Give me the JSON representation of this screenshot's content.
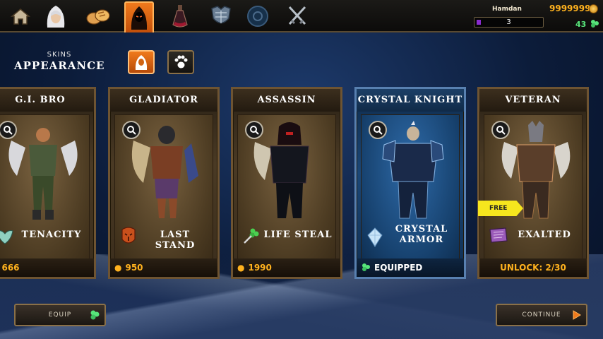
{
  "tabs": [
    {
      "id": "home",
      "icon": "home-icon"
    },
    {
      "id": "heroes",
      "icon": "hooded-woman-portrait-icon"
    },
    {
      "id": "resources",
      "icon": "bread-loaves-icon"
    },
    {
      "id": "skins",
      "icon": "hooded-assassin-icon",
      "active": true
    },
    {
      "id": "potions",
      "icon": "potion-flask-icon"
    },
    {
      "id": "armor",
      "icon": "armor-chest-icon"
    },
    {
      "id": "emblem",
      "icon": "round-emblem-icon"
    },
    {
      "id": "weapons",
      "icon": "crossed-swords-icon"
    }
  ],
  "player": {
    "name": "Hamdan",
    "level": "3",
    "gold": "9999999",
    "gems": "43"
  },
  "section": {
    "subtitle": "SKINS",
    "title": "APPEARANCE"
  },
  "filters": [
    {
      "icon": "hood-filter-icon",
      "active": true
    },
    {
      "icon": "paw-filter-icon",
      "active": false
    }
  ],
  "cards": [
    {
      "title": "G.I. BRO",
      "ability": "TENACITY",
      "ability_icon": "winged-shield-icon",
      "price": "666",
      "state": "buy"
    },
    {
      "title": "GLADIATOR",
      "ability": "LAST STAND",
      "ability_icon": "tribal-mask-icon",
      "price": "950",
      "state": "buy"
    },
    {
      "title": "ASSASSIN",
      "ability": "LIFE STEAL",
      "ability_icon": "clover-dagger-icon",
      "price": "1990",
      "state": "buy"
    },
    {
      "title": "CRYSTAL KNIGHT",
      "ability_line1": "CRYSTAL",
      "ability_line2": "ARMOR",
      "ability_icon": "crystal-icon",
      "status": "EQUIPPED",
      "state": "equipped"
    },
    {
      "title": "VETERAN",
      "ability": "EXALTED",
      "ability_icon": "scroll-book-icon",
      "unlock": "UNLOCK: 2/30",
      "tag": "FREE",
      "state": "locked"
    }
  ],
  "buttons": {
    "equip": "EQUIP",
    "continue": "CONTINUE"
  },
  "colors": {
    "accent_orange": "#f07a1c",
    "gold_text": "#ffb21e",
    "gem_green": "#57e57a",
    "equipped_blue": "#1b4777",
    "free_tag": "#f6e61e"
  }
}
